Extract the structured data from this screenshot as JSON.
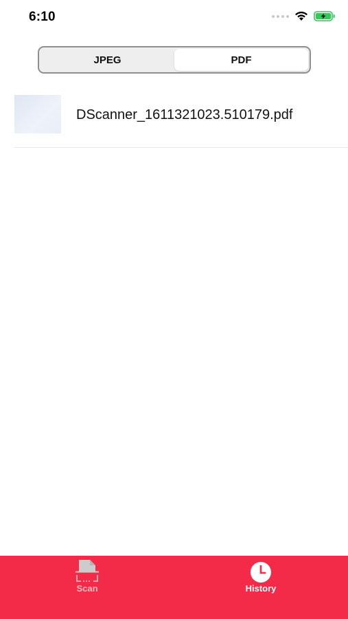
{
  "status_bar": {
    "time": "6:10",
    "battery_color": "#34c759"
  },
  "segmented_control": {
    "segments": [
      {
        "label": "JPEG",
        "selected": false
      },
      {
        "label": "PDF",
        "selected": true
      }
    ]
  },
  "files": [
    {
      "name": "DScanner_1611321023.510179.pdf",
      "thumbnail_icon": "document-thumbnail"
    }
  ],
  "tab_bar": {
    "background_color": "#f42b48",
    "tabs": [
      {
        "label": "Scan",
        "icon": "scan-document-icon",
        "active": false
      },
      {
        "label": "History",
        "icon": "clock-icon",
        "active": true
      }
    ]
  }
}
